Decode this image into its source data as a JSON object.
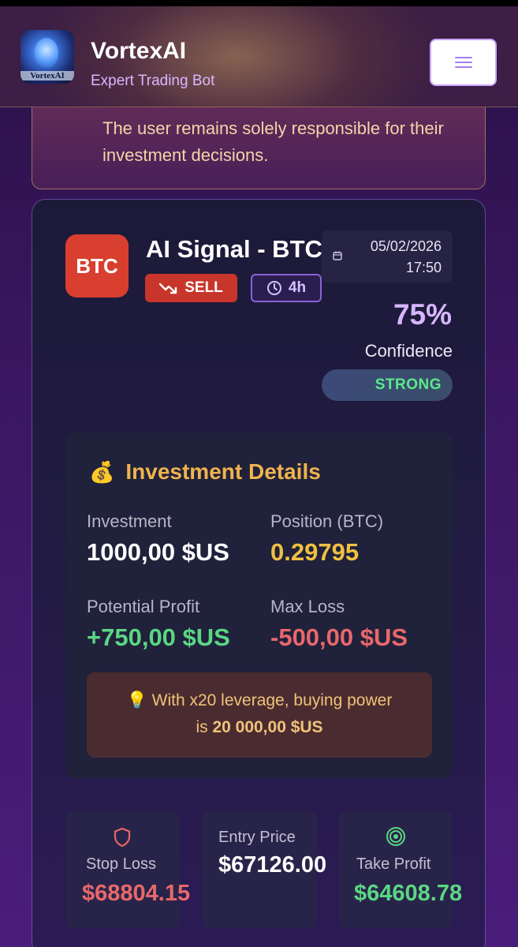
{
  "header": {
    "logo_text": "VortexAI",
    "title": "VortexAI",
    "subtitle": "Expert Trading Bot",
    "menu_icon": "hamburger-icon"
  },
  "disclaimer": {
    "text": "The user remains solely responsible for their investment decisions."
  },
  "signal": {
    "coin": "BTC",
    "title": "AI Signal - BTC",
    "direction": "SELL",
    "timeframe": "4h",
    "date": "05/02/2026",
    "time": "17:50",
    "confidence": "75%",
    "confidence_label": "Confidence",
    "strength": "STRONG"
  },
  "investment": {
    "icon": "💰",
    "title": "Investment Details",
    "investment_label": "Investment",
    "investment_value": "1000,00 $US",
    "position_label": "Position (BTC)",
    "position_value": "0.29795",
    "profit_label": "Potential Profit",
    "profit_value": "+750,00 $US",
    "loss_label": "Max Loss",
    "loss_value": "-500,00 $US",
    "leverage_icon": "💡",
    "leverage_text": "With x20 leverage, buying power",
    "leverage_prefix": "is",
    "leverage_amount": "20 000,00 $US"
  },
  "levels": {
    "stop_loss_label": "Stop Loss",
    "stop_loss_value": "$68804.15",
    "entry_label": "Entry Price",
    "entry_value": "$67126.00",
    "take_profit_label": "Take Profit",
    "take_profit_value": "$64608.78"
  },
  "colors": {
    "sell": "#c8352b",
    "profit": "#5ad783",
    "loss": "#e8686a",
    "accent": "#d7b6ff",
    "gold": "#f0b34e"
  }
}
